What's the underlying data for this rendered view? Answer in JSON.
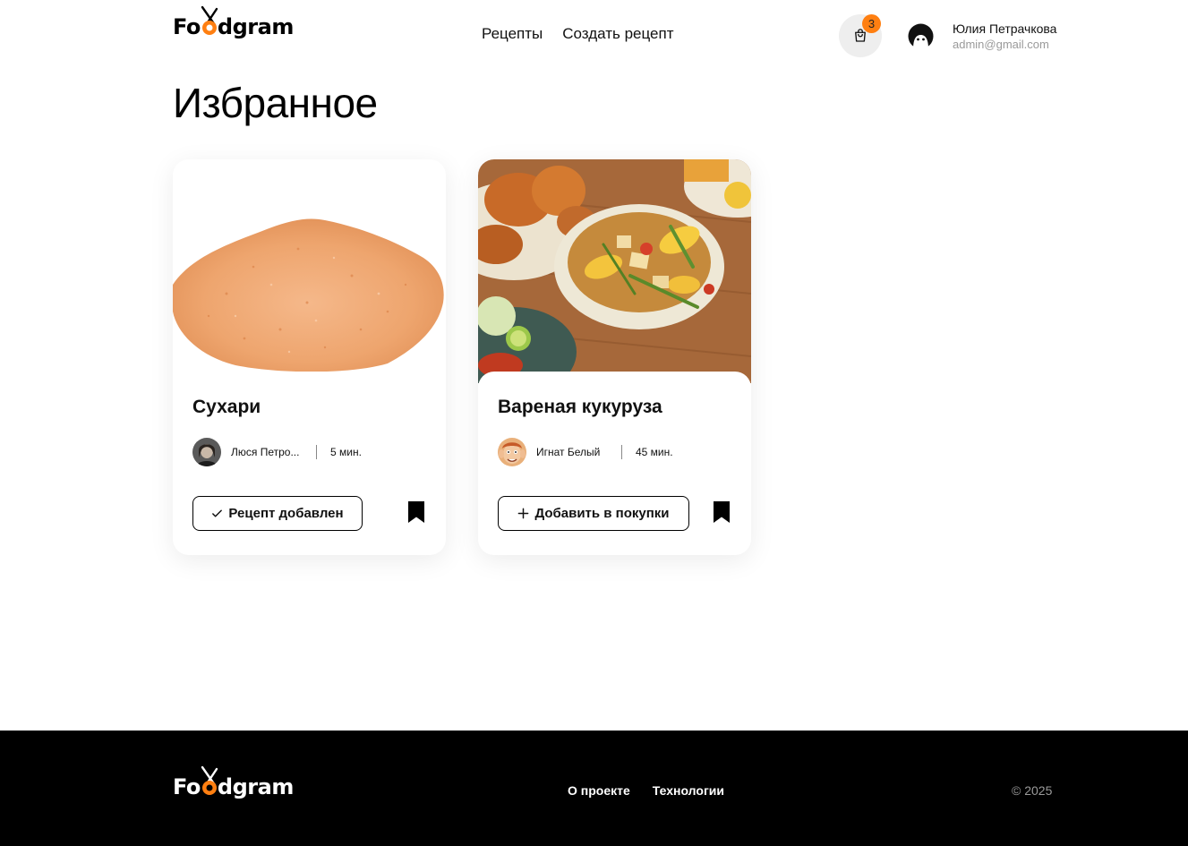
{
  "brand": {
    "logo_prefix": "Fo",
    "logo_suffix": "dgram",
    "accent_color": "#ff7f11"
  },
  "header": {
    "nav": [
      {
        "label": "Рецепты"
      },
      {
        "label": "Создать рецепт"
      }
    ],
    "cart_count": "3",
    "user": {
      "name": "Юлия Петрачкова",
      "email": "admin@gmail.com"
    }
  },
  "page": {
    "title": "Избранное"
  },
  "recipes": [
    {
      "title": "Сухари",
      "author": "Люся Петро...",
      "time": "5 мин.",
      "button_label": "Рецепт добавлен",
      "button_icon": "check-icon",
      "bookmarked": true
    },
    {
      "title": "Вареная кукуруза",
      "author": "Игнат Белый",
      "time": "45 мин.",
      "button_label": "Добавить в покупки",
      "button_icon": "plus-icon",
      "bookmarked": true
    }
  ],
  "footer": {
    "links": [
      {
        "label": "О проекте"
      },
      {
        "label": "Технологии"
      }
    ],
    "copyright": "© 2025"
  }
}
